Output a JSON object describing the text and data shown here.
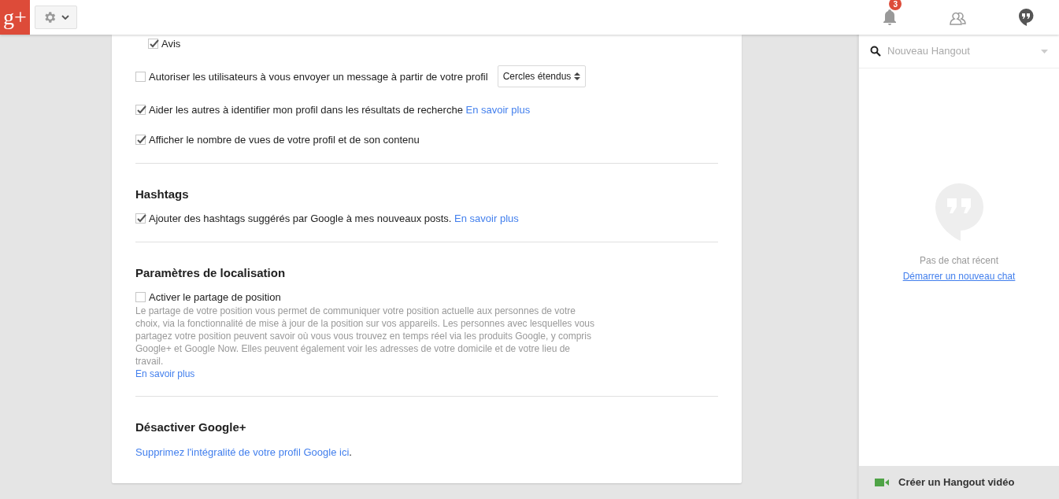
{
  "topbar": {
    "logo": "g+",
    "notifications": {
      "count": "3"
    }
  },
  "settings": {
    "sections": [
      {
        "items": [
          {
            "kind": "subgroup",
            "children": [
              {
                "kind": "checkbox",
                "label": "Avis",
                "checked": true
              }
            ]
          },
          {
            "kind": "checkbox",
            "label": "Autoriser les utilisateurs à vous envoyer un message à partir de votre profil",
            "checked": false,
            "select": "Cercles étendus"
          },
          {
            "kind": "checkbox",
            "label": "Aider les autres à identifier mon profil dans les résultats de recherche",
            "checked": true,
            "link": "En savoir plus"
          },
          {
            "kind": "checkbox",
            "label": "Afficher le nombre de vues de votre profil et de son contenu",
            "checked": true
          }
        ]
      },
      {
        "title": "Hashtags",
        "items": [
          {
            "kind": "checkbox",
            "label": "Ajouter des hashtags suggérés par Google à mes nouveaux posts.",
            "checked": true,
            "link": "En savoir plus"
          }
        ]
      },
      {
        "title": "Paramètres de localisation",
        "items": [
          {
            "kind": "checkbox",
            "label": "Activer le partage de position",
            "checked": false
          },
          {
            "kind": "description",
            "text": "Le partage de votre position vous permet de communiquer votre position actuelle aux personnes de votre choix, via la fonctionnalité de mise à jour de la position sur vos appareils. Les personnes avec lesquelles vous partagez votre position peuvent savoir où vous vous trouvez en temps réel via les produits Google, y compris Google+ et Google Now. Elles peuvent également voir les adresses de votre domicile et de votre lieu de travail.",
            "link": "En savoir plus"
          }
        ]
      },
      {
        "title": "Désactiver Google+",
        "items": [
          {
            "kind": "linktext",
            "link": "Supprimez l'intégralité de votre profil Google ici",
            "suffix": "."
          }
        ]
      }
    ]
  },
  "hangouts": {
    "search_placeholder": "Nouveau Hangout",
    "empty_text": "Pas de chat récent",
    "start_link": "Démarrer un nouveau chat",
    "video_button": "Créer un Hangout vidéo"
  }
}
